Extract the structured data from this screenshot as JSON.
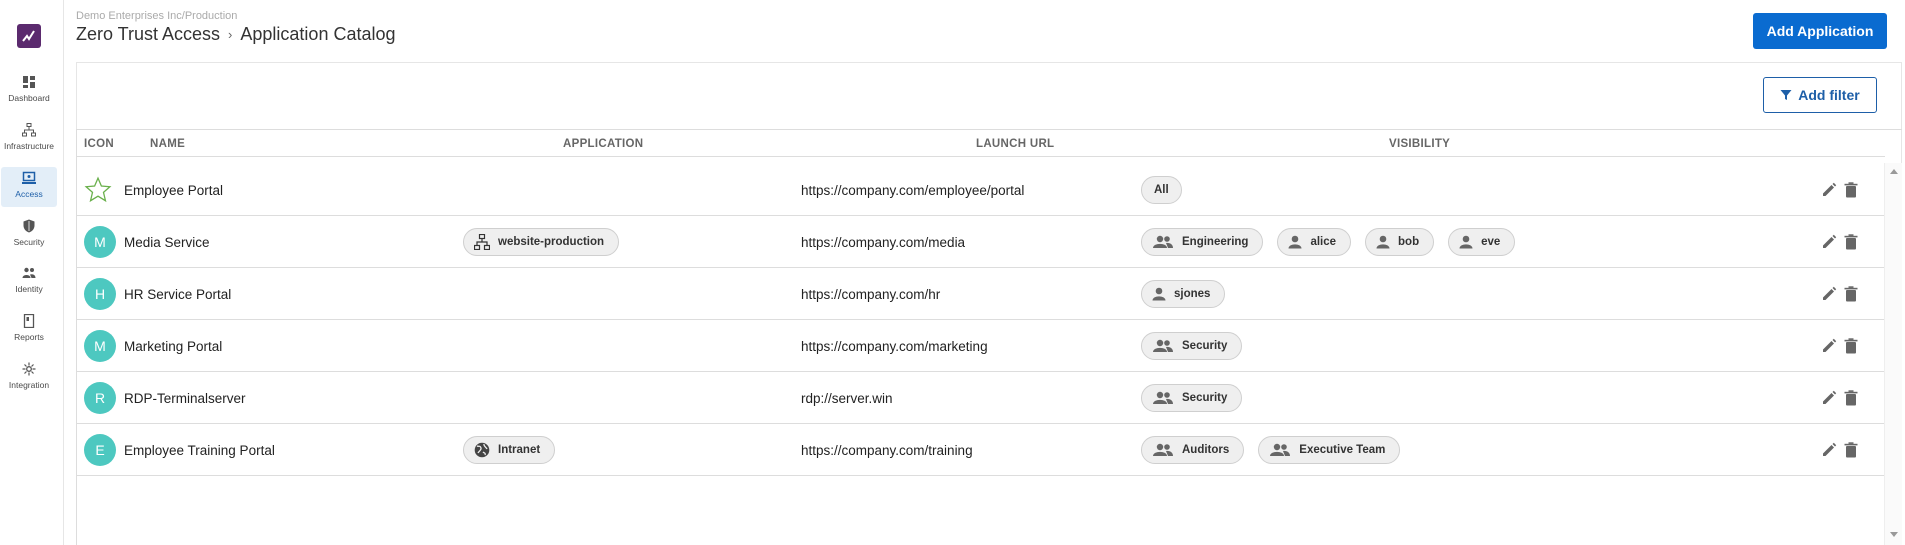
{
  "sidebar": {
    "items": [
      {
        "label": "Dashboard",
        "icon": "dashboard-icon",
        "active": false
      },
      {
        "label": "Infrastructure",
        "icon": "infrastructure-icon",
        "active": false
      },
      {
        "label": "Access",
        "icon": "access-icon",
        "active": true
      },
      {
        "label": "Security",
        "icon": "shield-icon",
        "active": false
      },
      {
        "label": "Identity",
        "icon": "people-icon",
        "active": false
      },
      {
        "label": "Reports",
        "icon": "report-icon",
        "active": false
      },
      {
        "label": "Integration",
        "icon": "integration-icon",
        "active": false
      }
    ]
  },
  "header": {
    "org": "Demo Enterprises Inc/Production",
    "breadcrumb": [
      "Zero Trust Access",
      "Application Catalog"
    ],
    "add_application_label": "Add Application"
  },
  "toolbar": {
    "add_filter_label": "Add filter"
  },
  "table": {
    "columns": [
      "ICON",
      "NAME",
      "APPLICATION",
      "LAUNCH URL",
      "VISIBILITY"
    ],
    "rows": [
      {
        "icon": "star",
        "initial": "",
        "name": "Employee Portal",
        "application": null,
        "url": "https://company.com/employee/portal",
        "visibility": [
          {
            "label": "All",
            "type": "none"
          }
        ]
      },
      {
        "icon": "avatar",
        "initial": "M",
        "name": "Media Service",
        "application": {
          "label": "website-production",
          "icon": "sitemap-icon"
        },
        "url": "https://company.com/media",
        "visibility": [
          {
            "label": "Engineering",
            "type": "group"
          },
          {
            "label": "alice",
            "type": "user"
          },
          {
            "label": "bob",
            "type": "user"
          },
          {
            "label": "eve",
            "type": "user"
          }
        ]
      },
      {
        "icon": "avatar",
        "initial": "H",
        "name": "HR Service Portal",
        "application": null,
        "url": "https://company.com/hr",
        "visibility": [
          {
            "label": "sjones",
            "type": "user"
          }
        ]
      },
      {
        "icon": "avatar",
        "initial": "M",
        "name": "Marketing Portal",
        "application": null,
        "url": "https://company.com/marketing",
        "visibility": [
          {
            "label": "Security",
            "type": "group"
          }
        ]
      },
      {
        "icon": "avatar",
        "initial": "R",
        "name": "RDP-Terminalserver",
        "application": null,
        "url": "rdp://server.win",
        "visibility": [
          {
            "label": "Security",
            "type": "group"
          }
        ]
      },
      {
        "icon": "avatar",
        "initial": "E",
        "name": "Employee Training Portal",
        "application": {
          "label": "Intranet",
          "icon": "globe-icon"
        },
        "url": "https://company.com/training",
        "visibility": [
          {
            "label": "Auditors",
            "type": "group"
          },
          {
            "label": "Executive Team",
            "type": "group"
          }
        ]
      }
    ]
  },
  "colors": {
    "primary": "#0a6bd0",
    "avatar": "#4dc8c0",
    "logo": "#5b2a6e",
    "star": "#6ab04c"
  }
}
